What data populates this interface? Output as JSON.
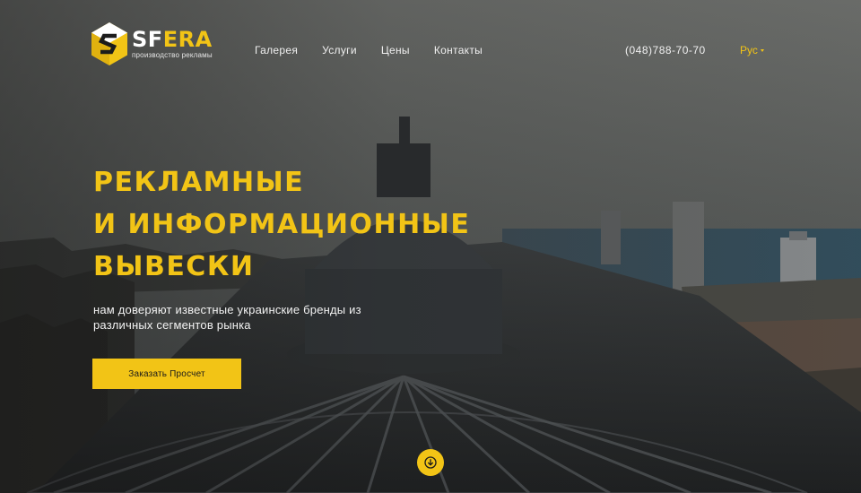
{
  "brand": {
    "name_prefix": "SF",
    "name_suffix": "ERA",
    "tagline": "производство рекламы",
    "accent_color": "#f2c416",
    "icon": "sfera-logo-icon"
  },
  "nav": {
    "items": [
      {
        "label": "Галерея"
      },
      {
        "label": "Услуги"
      },
      {
        "label": "Цены"
      },
      {
        "label": "Контакты"
      }
    ]
  },
  "header": {
    "phone": "(048)788-70-70",
    "language": "Рус",
    "language_icon": "chevron-down-icon"
  },
  "hero": {
    "title_lines": [
      "РЕКЛАМНЫЕ",
      "И ИНФОРМАЦИОННЫЕ",
      "ВЫВЕСКИ"
    ],
    "subtitle": "нам доверяют известные украинские бренды из различных сегментов рынка",
    "cta_label": "Заказать Просчет",
    "scroll_icon": "arrow-down-icon",
    "background": "city-rooftop-dome-photo"
  }
}
